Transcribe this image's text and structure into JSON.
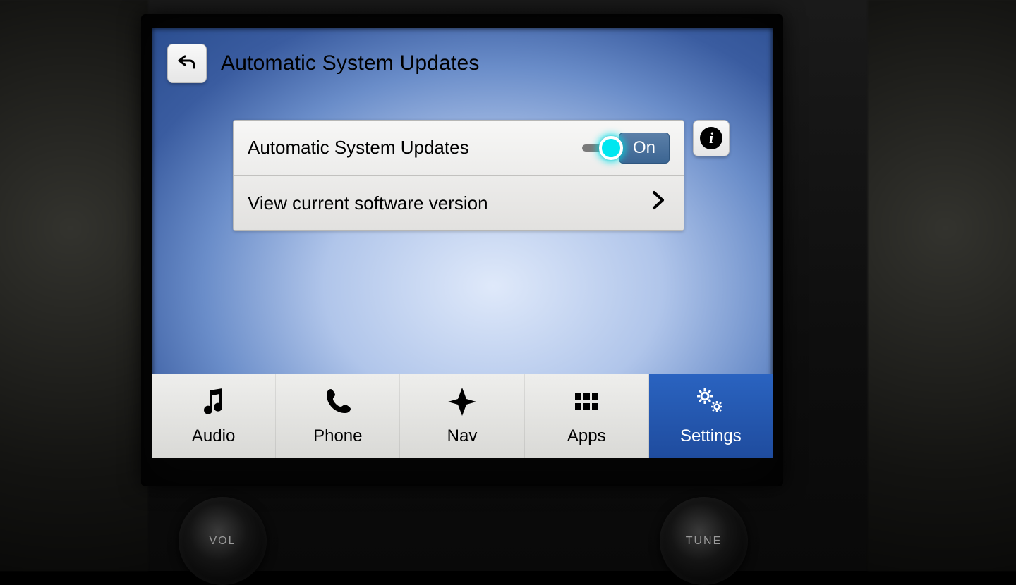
{
  "header": {
    "title": "Automatic System Updates"
  },
  "settings": {
    "auto_update": {
      "label": "Automatic System Updates",
      "state_label": "On",
      "state": true
    },
    "view_version": {
      "label": "View current software version"
    },
    "info_glyph": "i"
  },
  "tabs": [
    {
      "id": "audio",
      "label": "Audio",
      "icon": "music-icon",
      "active": false
    },
    {
      "id": "phone",
      "label": "Phone",
      "icon": "phone-icon",
      "active": false
    },
    {
      "id": "nav",
      "label": "Nav",
      "icon": "compass-icon",
      "active": false
    },
    {
      "id": "apps",
      "label": "Apps",
      "icon": "grid-icon",
      "active": false
    },
    {
      "id": "settings",
      "label": "Settings",
      "icon": "gears-icon",
      "active": true
    }
  ],
  "knobs": {
    "left": "VOL",
    "right": "TUNE"
  }
}
